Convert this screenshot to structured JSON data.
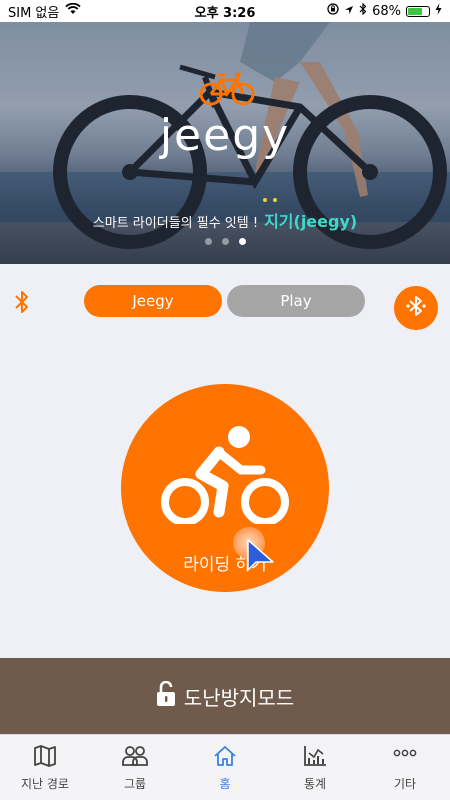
{
  "status_bar": {
    "carrier": "SIM 없음",
    "time": "오후 3:26",
    "battery": "68%",
    "battery_level": 0.68
  },
  "hero": {
    "brand": "jeegy",
    "tagline": "스마트 라이더들의 필수 잇템 !",
    "tagline_highlight": "지기(jeegy)",
    "page_count": 3,
    "active_page": 2
  },
  "segments": {
    "left_label": "Jeegy",
    "right_label": "Play",
    "selected": "Jeegy"
  },
  "ride_button": {
    "label": "라이딩 하기"
  },
  "theft_mode": {
    "label": "도난방지모드"
  },
  "tabs": [
    {
      "label": "지난 경로",
      "icon": "map-icon",
      "active": false
    },
    {
      "label": "그룹",
      "icon": "group-icon",
      "active": false
    },
    {
      "label": "홈",
      "icon": "home-icon",
      "active": true
    },
    {
      "label": "통계",
      "icon": "stats-icon",
      "active": false
    },
    {
      "label": "기타",
      "icon": "more-icon",
      "active": false
    }
  ],
  "colors": {
    "accent": "#ff7300",
    "inactive_segment": "#a6a6a6",
    "theft_bar": "#705a4b",
    "active_tab": "#3a82e0",
    "tagline_highlight": "#3fd9c8"
  }
}
